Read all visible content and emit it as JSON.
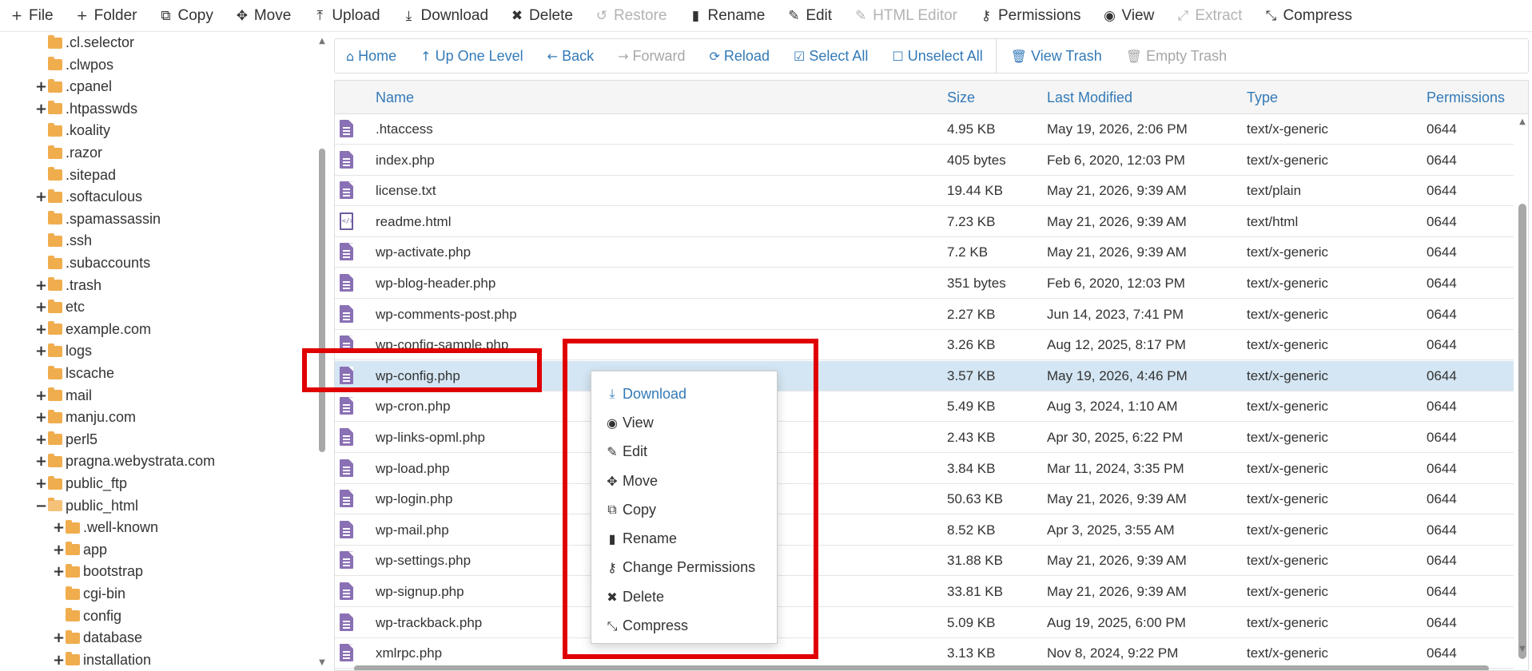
{
  "toolbar": {
    "items": [
      {
        "label": "File",
        "icon": "plus-icon",
        "glyph": "+",
        "disabled": false
      },
      {
        "label": "Folder",
        "icon": "plus-icon",
        "glyph": "+",
        "disabled": false
      },
      {
        "label": "Copy",
        "icon": "copy-icon",
        "glyph": "⧉",
        "disabled": false
      },
      {
        "label": "Move",
        "icon": "move-icon",
        "glyph": "✥",
        "disabled": false
      },
      {
        "label": "Upload",
        "icon": "upload-icon",
        "glyph": "⤒",
        "disabled": false
      },
      {
        "label": "Download",
        "icon": "download-icon",
        "glyph": "⤓",
        "disabled": false
      },
      {
        "label": "Delete",
        "icon": "delete-icon",
        "glyph": "✖",
        "disabled": false
      },
      {
        "label": "Restore",
        "icon": "restore-icon",
        "glyph": "↺",
        "disabled": true
      },
      {
        "label": "Rename",
        "icon": "rename-icon",
        "glyph": "▮",
        "disabled": false
      },
      {
        "label": "Edit",
        "icon": "edit-icon",
        "glyph": "✎",
        "disabled": false
      },
      {
        "label": "HTML Editor",
        "icon": "html-editor-icon",
        "glyph": "✎",
        "disabled": true
      },
      {
        "label": "Permissions",
        "icon": "key-icon",
        "glyph": "⚷",
        "disabled": false
      },
      {
        "label": "View",
        "icon": "eye-icon",
        "glyph": "◉",
        "disabled": false
      },
      {
        "label": "Extract",
        "icon": "extract-icon",
        "glyph": "⤢",
        "disabled": true
      },
      {
        "label": "Compress",
        "icon": "compress-icon",
        "glyph": "⤡",
        "disabled": false
      }
    ]
  },
  "tree": {
    "items": [
      {
        "label": ".cl.selector",
        "indent": 1,
        "expand": ""
      },
      {
        "label": ".clwpos",
        "indent": 1,
        "expand": ""
      },
      {
        "label": ".cpanel",
        "indent": 1,
        "expand": "+"
      },
      {
        "label": ".htpasswds",
        "indent": 1,
        "expand": "+"
      },
      {
        "label": ".koality",
        "indent": 1,
        "expand": ""
      },
      {
        "label": ".razor",
        "indent": 1,
        "expand": ""
      },
      {
        "label": ".sitepad",
        "indent": 1,
        "expand": ""
      },
      {
        "label": ".softaculous",
        "indent": 1,
        "expand": "+"
      },
      {
        "label": ".spamassassin",
        "indent": 1,
        "expand": ""
      },
      {
        "label": ".ssh",
        "indent": 1,
        "expand": ""
      },
      {
        "label": ".subaccounts",
        "indent": 1,
        "expand": ""
      },
      {
        "label": ".trash",
        "indent": 1,
        "expand": "+"
      },
      {
        "label": "etc",
        "indent": 1,
        "expand": "+"
      },
      {
        "label": "example.com",
        "indent": 1,
        "expand": "+"
      },
      {
        "label": "logs",
        "indent": 1,
        "expand": "+"
      },
      {
        "label": "lscache",
        "indent": 1,
        "expand": ""
      },
      {
        "label": "mail",
        "indent": 1,
        "expand": "+"
      },
      {
        "label": "manju.com",
        "indent": 1,
        "expand": "+"
      },
      {
        "label": "perl5",
        "indent": 1,
        "expand": "+"
      },
      {
        "label": "pragna.webystrata.com",
        "indent": 1,
        "expand": "+"
      },
      {
        "label": "public_ftp",
        "indent": 1,
        "expand": "+"
      },
      {
        "label": "public_html",
        "indent": 1,
        "expand": "−",
        "open": true
      },
      {
        "label": ".well-known",
        "indent": 2,
        "expand": "+"
      },
      {
        "label": "app",
        "indent": 2,
        "expand": "+"
      },
      {
        "label": "bootstrap",
        "indent": 2,
        "expand": "+"
      },
      {
        "label": "cgi-bin",
        "indent": 2,
        "expand": ""
      },
      {
        "label": "config",
        "indent": 2,
        "expand": ""
      },
      {
        "label": "database",
        "indent": 2,
        "expand": "+"
      },
      {
        "label": "installation",
        "indent": 2,
        "expand": "+"
      }
    ]
  },
  "nav": {
    "items": [
      {
        "label": "Home",
        "icon": "home-icon",
        "glyph": "⌂",
        "disabled": false
      },
      {
        "label": "Up One Level",
        "icon": "up-arrow-icon",
        "glyph": "↑",
        "disabled": false
      },
      {
        "label": "Back",
        "icon": "back-arrow-icon",
        "glyph": "←",
        "disabled": false
      },
      {
        "label": "Forward",
        "icon": "forward-arrow-icon",
        "glyph": "→",
        "disabled": true
      },
      {
        "label": "Reload",
        "icon": "reload-icon",
        "glyph": "⟳",
        "disabled": false
      },
      {
        "label": "Select All",
        "icon": "checkbox-checked-icon",
        "glyph": "☑",
        "disabled": false
      },
      {
        "label": "Unselect All",
        "icon": "checkbox-empty-icon",
        "glyph": "☐",
        "disabled": false
      },
      {
        "label": "View Trash",
        "icon": "trash-icon",
        "glyph": "🗑",
        "disabled": false
      },
      {
        "label": "Empty Trash",
        "icon": "trash-icon",
        "glyph": "🗑",
        "disabled": true
      }
    ]
  },
  "table": {
    "headers": {
      "name": "Name",
      "size": "Size",
      "modified": "Last Modified",
      "type": "Type",
      "perms": "Permissions"
    },
    "rows": [
      {
        "name": ".htaccess",
        "size": "4.95 KB",
        "modified": "May 19, 2026, 2:06 PM",
        "type": "text/x-generic",
        "perms": "0644",
        "kind": "generic"
      },
      {
        "name": "index.php",
        "size": "405 bytes",
        "modified": "Feb 6, 2020, 12:03 PM",
        "type": "text/x-generic",
        "perms": "0644",
        "kind": "generic"
      },
      {
        "name": "license.txt",
        "size": "19.44 KB",
        "modified": "May 21, 2026, 9:39 AM",
        "type": "text/plain",
        "perms": "0644",
        "kind": "generic"
      },
      {
        "name": "readme.html",
        "size": "7.23 KB",
        "modified": "May 21, 2026, 9:39 AM",
        "type": "text/html",
        "perms": "0644",
        "kind": "html"
      },
      {
        "name": "wp-activate.php",
        "size": "7.2 KB",
        "modified": "May 21, 2026, 9:39 AM",
        "type": "text/x-generic",
        "perms": "0644",
        "kind": "generic"
      },
      {
        "name": "wp-blog-header.php",
        "size": "351 bytes",
        "modified": "Feb 6, 2020, 12:03 PM",
        "type": "text/x-generic",
        "perms": "0644",
        "kind": "generic"
      },
      {
        "name": "wp-comments-post.php",
        "size": "2.27 KB",
        "modified": "Jun 14, 2023, 7:41 PM",
        "type": "text/x-generic",
        "perms": "0644",
        "kind": "generic"
      },
      {
        "name": "wp-config-sample.php",
        "size": "3.26 KB",
        "modified": "Aug 12, 2025, 8:17 PM",
        "type": "text/x-generic",
        "perms": "0644",
        "kind": "generic"
      },
      {
        "name": "wp-config.php",
        "size": "3.57 KB",
        "modified": "May 19, 2026, 4:46 PM",
        "type": "text/x-generic",
        "perms": "0644",
        "kind": "generic",
        "selected": true
      },
      {
        "name": "wp-cron.php",
        "size": "5.49 KB",
        "modified": "Aug 3, 2024, 1:10 AM",
        "type": "text/x-generic",
        "perms": "0644",
        "kind": "generic"
      },
      {
        "name": "wp-links-opml.php",
        "size": "2.43 KB",
        "modified": "Apr 30, 2025, 6:22 PM",
        "type": "text/x-generic",
        "perms": "0644",
        "kind": "generic"
      },
      {
        "name": "wp-load.php",
        "size": "3.84 KB",
        "modified": "Mar 11, 2024, 3:35 PM",
        "type": "text/x-generic",
        "perms": "0644",
        "kind": "generic"
      },
      {
        "name": "wp-login.php",
        "size": "50.63 KB",
        "modified": "May 21, 2026, 9:39 AM",
        "type": "text/x-generic",
        "perms": "0644",
        "kind": "generic"
      },
      {
        "name": "wp-mail.php",
        "size": "8.52 KB",
        "modified": "Apr 3, 2025, 3:55 AM",
        "type": "text/x-generic",
        "perms": "0644",
        "kind": "generic"
      },
      {
        "name": "wp-settings.php",
        "size": "31.88 KB",
        "modified": "May 21, 2026, 9:39 AM",
        "type": "text/x-generic",
        "perms": "0644",
        "kind": "generic"
      },
      {
        "name": "wp-signup.php",
        "size": "33.81 KB",
        "modified": "May 21, 2026, 9:39 AM",
        "type": "text/x-generic",
        "perms": "0644",
        "kind": "generic"
      },
      {
        "name": "wp-trackback.php",
        "size": "5.09 KB",
        "modified": "Aug 19, 2025, 6:00 PM",
        "type": "text/x-generic",
        "perms": "0644",
        "kind": "generic"
      },
      {
        "name": "xmlrpc.php",
        "size": "3.13 KB",
        "modified": "Nov 8, 2024, 9:22 PM",
        "type": "text/x-generic",
        "perms": "0644",
        "kind": "generic"
      }
    ]
  },
  "context_menu": {
    "items": [
      {
        "label": "Download",
        "icon": "download-icon",
        "glyph": "⤓"
      },
      {
        "label": "View",
        "icon": "eye-icon",
        "glyph": "◉"
      },
      {
        "label": "Edit",
        "icon": "edit-icon",
        "glyph": "✎"
      },
      {
        "label": "Move",
        "icon": "move-icon",
        "glyph": "✥"
      },
      {
        "label": "Copy",
        "icon": "copy-icon",
        "glyph": "⧉"
      },
      {
        "label": "Rename",
        "icon": "rename-icon",
        "glyph": "▮"
      },
      {
        "label": "Change Permissions",
        "icon": "key-icon",
        "glyph": "⚷"
      },
      {
        "label": "Delete",
        "icon": "delete-icon",
        "glyph": "✖"
      },
      {
        "label": "Compress",
        "icon": "compress-icon",
        "glyph": "⤡"
      }
    ]
  },
  "colors": {
    "accent": "#337ab7",
    "disabled": "#b3b3b3",
    "folder": "#f0ad4e",
    "file_icon": "#8a70b4",
    "selected_row": "#d4e6f3",
    "highlight": "#e00000"
  }
}
